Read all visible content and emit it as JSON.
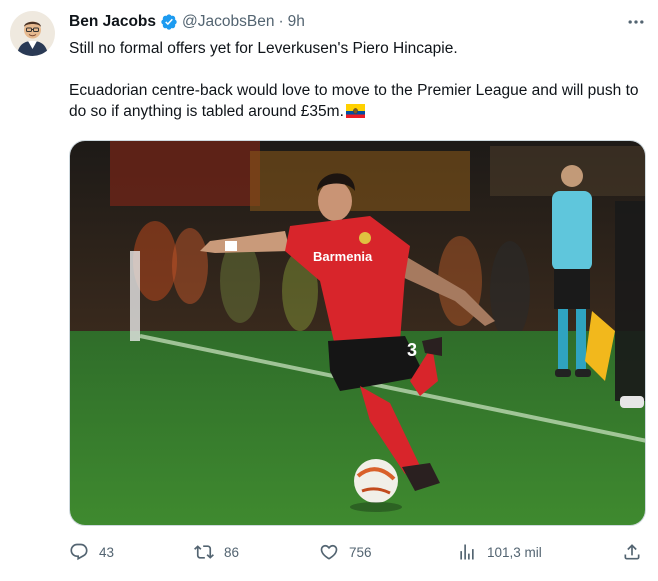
{
  "tweet": {
    "author_name": "Ben Jacobs",
    "handle": "@JacobsBen",
    "separator": "·",
    "time": "9h",
    "text_line1": "Still no formal offers yet for Leverkusen's Piero Hincapie.",
    "text_line2": "Ecuadorian centre-back would love to move to the Premier League and will push to do so if anything is tabled around £35m.",
    "flag_icon": "ecuador-flag-icon",
    "media": {
      "shirt_sponsor": "Barmenia",
      "shirt_number": "3"
    }
  },
  "actions": {
    "replies": "43",
    "retweets": "86",
    "likes": "756",
    "views": "101,3 mil"
  },
  "colors": {
    "verified": "#1d9bf0",
    "muted": "#536471",
    "text": "#0f1419"
  }
}
